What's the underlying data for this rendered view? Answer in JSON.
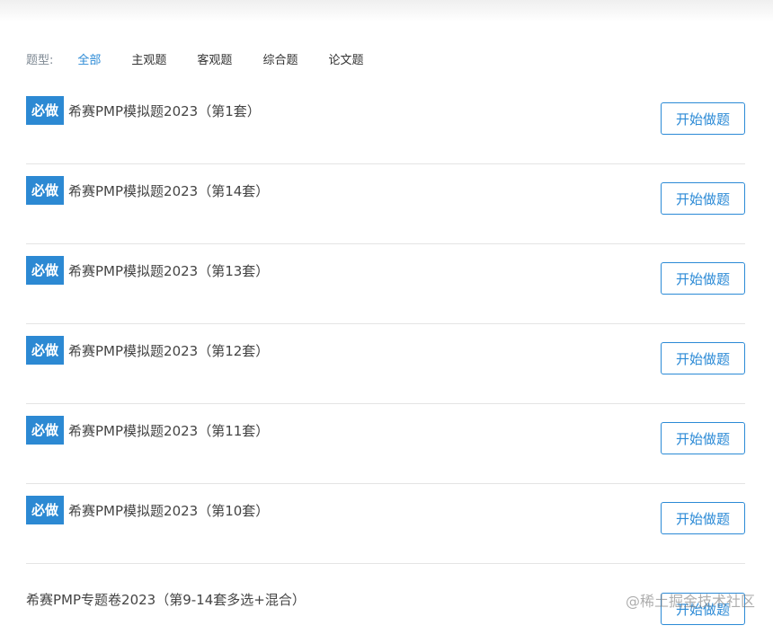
{
  "filter": {
    "label": "题型:",
    "items": [
      "全部",
      "主观题",
      "客观题",
      "综合题",
      "论文题"
    ],
    "active_index": 0
  },
  "badge_label": "必做",
  "start_label": "开始做题",
  "items": [
    {
      "title": "希赛PMP模拟题2023（第1套）",
      "required": true
    },
    {
      "title": "希赛PMP模拟题2023（第14套）",
      "required": true
    },
    {
      "title": "希赛PMP模拟题2023（第13套）",
      "required": true
    },
    {
      "title": "希赛PMP模拟题2023（第12套）",
      "required": true
    },
    {
      "title": "希赛PMP模拟题2023（第11套）",
      "required": true
    },
    {
      "title": "希赛PMP模拟题2023（第10套）",
      "required": true
    },
    {
      "title": "希赛PMP专题卷2023（第9-14套多选+混合）",
      "required": false
    }
  ],
  "watermark": "@稀土掘金技术社区",
  "colors": {
    "accent": "#2b8ad6",
    "badge_bg": "#2c89d3"
  }
}
